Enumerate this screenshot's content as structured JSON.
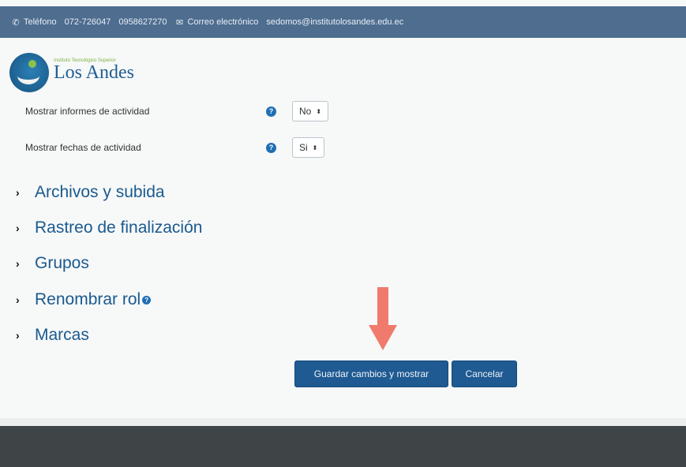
{
  "topbar": {
    "phone_label": "Teléfono",
    "phone_1": "072-726047",
    "phone_2": "0958627270",
    "email_label": "Correo electrónico",
    "email": "sedomos@institutolosandes.edu.ec"
  },
  "logo": {
    "tagline": "Instituto Tecnológico Superior",
    "name": "Los Andes"
  },
  "fields": [
    {
      "label": "Mostrar informes de actividad",
      "value": "No"
    },
    {
      "label": "Mostrar fechas de actividad",
      "value": "Si"
    }
  ],
  "sections": [
    {
      "label": "Archivos y subida"
    },
    {
      "label": "Rastreo de finalización"
    },
    {
      "label": "Grupos"
    },
    {
      "label": "Renombrar rol"
    },
    {
      "label": "Marcas"
    }
  ],
  "buttons": {
    "save": "Guardar cambios y mostrar",
    "cancel": "Cancelar"
  },
  "colors": {
    "topbar": "#4e6d8f",
    "primary_button": "#1f5a92",
    "section_text": "#1a5a8f",
    "annotation_arrow": "#f07a6c",
    "footer": "#3f4446"
  },
  "icons": {
    "phone": "phone-icon",
    "email": "envelope-icon",
    "help": "question-circle-icon",
    "collapse": "chevron-right-icon",
    "annotation": "down-arrow-icon"
  }
}
